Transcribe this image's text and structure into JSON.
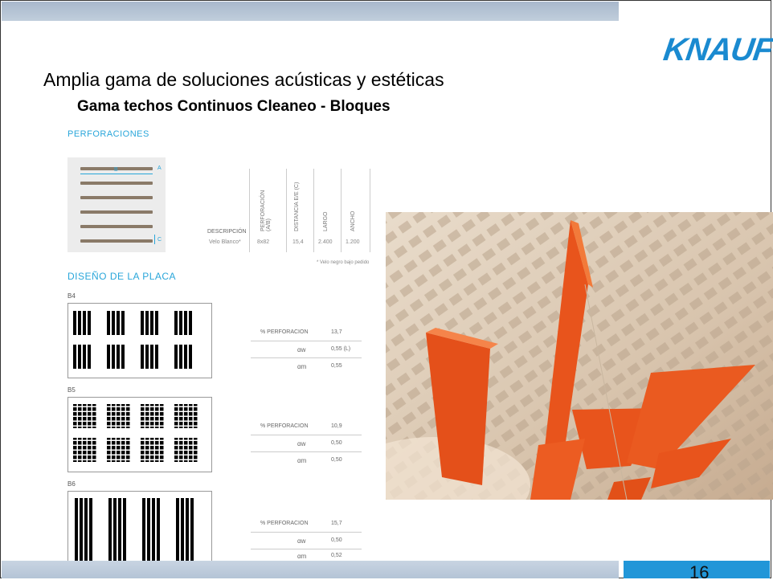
{
  "slide": {
    "logo": "KNAUF",
    "title": "Amplia gama de soluciones acústicas y estéticas",
    "subtitle": "Gama techos Continuos Cleaneo - Bloques",
    "page_number": "16"
  },
  "perforaciones": {
    "heading": "PERFORACIONES",
    "diagram_labels": {
      "a": "A",
      "b": "B",
      "c": "C"
    },
    "columns": [
      "DESCRIPCIÓN",
      "PERFORACIÓN (A/B)",
      "DISTANCIA E/E (C)",
      "LARGO",
      "ANCHO"
    ],
    "row": {
      "descripcion": "Velo Blanco*",
      "perforacion": "8x82",
      "distancia": "15,4",
      "largo": "2.400",
      "ancho": "1.200"
    },
    "footnote": "* Velo negro bajo pedido"
  },
  "diseno": {
    "heading": "DISEÑO DE LA PLACA",
    "plates": [
      {
        "name": "B4",
        "perforacion_label": "% PERFORACION",
        "perforacion": "13,7",
        "aw_label": "αw",
        "aw": "0,55 (L)",
        "am_label": "αm",
        "am": "0,55"
      },
      {
        "name": "B5",
        "perforacion_label": "% PERFORACION",
        "perforacion": "10,9",
        "aw_label": "αw",
        "aw": "0,50",
        "am_label": "αm",
        "am": "0,50"
      },
      {
        "name": "B6",
        "perforacion_label": "% PERFORACION",
        "perforacion": "15,7",
        "aw_label": "αw",
        "aw": "0,50",
        "am_label": "αm",
        "am": "0,52"
      }
    ]
  },
  "colors": {
    "accent": "#29a6da",
    "logo": "#1a8ad0",
    "page_box": "#2196d8",
    "orange_panels": "#e8541c"
  }
}
